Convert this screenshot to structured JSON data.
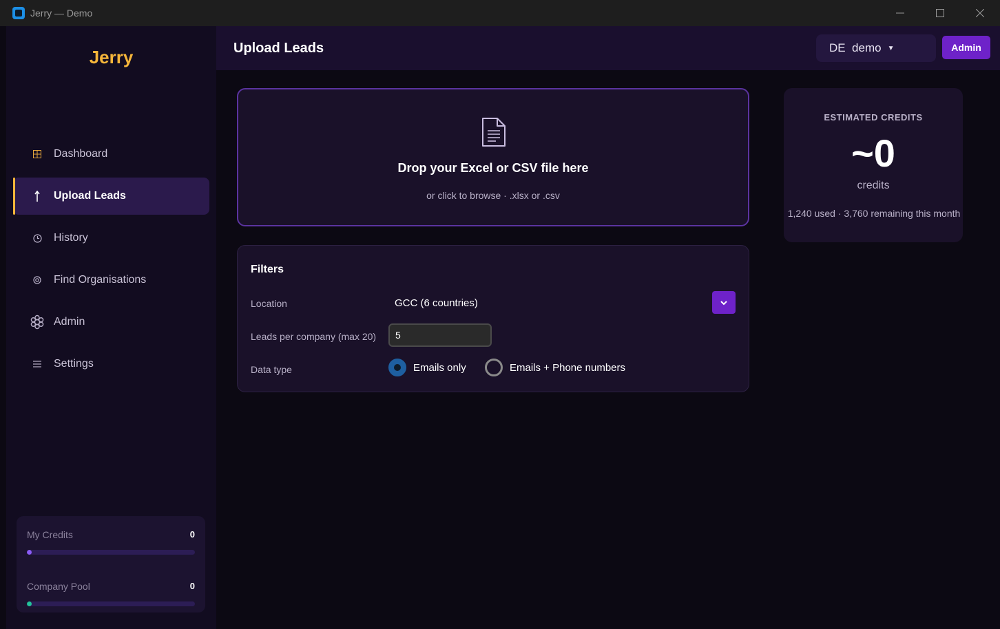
{
  "window": {
    "title": "Jerry — Demo"
  },
  "sidebar": {
    "brand": "Jerry",
    "items": [
      {
        "label": "Dashboard",
        "icon": "grid-icon",
        "active": false
      },
      {
        "label": "Upload Leads",
        "icon": "upload-arrow-icon",
        "active": true
      },
      {
        "label": "History",
        "icon": "clock-icon",
        "active": false
      },
      {
        "label": "Find Organisations",
        "icon": "target-icon",
        "active": false
      },
      {
        "label": "Admin",
        "icon": "gear-icon",
        "active": false
      },
      {
        "label": "Settings",
        "icon": "menu-lines-icon",
        "active": false
      }
    ],
    "credits": {
      "my_label": "My Credits",
      "my_value": "0",
      "my_fraction": 0.0,
      "my_color": "#8b5cf6",
      "pool_label": "Company Pool",
      "pool_value": "0",
      "pool_fraction": 0.0,
      "pool_color": "#22c39a"
    }
  },
  "header": {
    "title": "Upload Leads",
    "tenant": "DE  demo",
    "admin_label": "Admin"
  },
  "dropzone": {
    "title": "Drop your Excel or CSV file here",
    "subtitle": "or click to browse · .xlsx or .csv"
  },
  "filters": {
    "title": "Filters",
    "location_label": "Location",
    "location_value": "GCC (6 countries)",
    "leads_label": "Leads per company (max 20)",
    "leads_value": "5",
    "datatype_label": "Data type",
    "options": [
      {
        "label": "Emails only",
        "selected": true
      },
      {
        "label": "Emails + Phone numbers",
        "selected": false
      }
    ]
  },
  "estimate": {
    "title": "ESTIMATED CREDITS",
    "value": "~0",
    "unit": "credits",
    "footer": "1,240 used · 3,760 remaining this month"
  },
  "colors": {
    "accent": "#6e22c9",
    "brand": "#f4b53a",
    "background": "#0c0913"
  }
}
